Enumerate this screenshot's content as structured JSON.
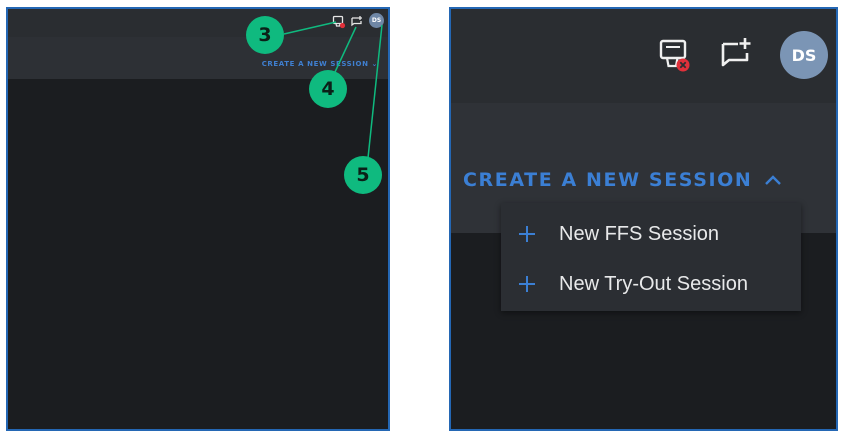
{
  "left_panel": {
    "avatar_initials": "DS",
    "create_session_label": "CREATE A NEW SESSION",
    "chevron": "chevron-down-icon",
    "callouts": [
      {
        "number": "3",
        "target": "notification-muted-icon"
      },
      {
        "number": "4",
        "target": "new-chat-icon"
      },
      {
        "number": "5",
        "target": "avatar"
      }
    ]
  },
  "right_panel": {
    "icons": [
      "notification-muted-icon",
      "new-chat-icon"
    ],
    "avatar_initials": "DS",
    "create_session_label": "CREATE A NEW SESSION",
    "chevron": "chevron-up-icon",
    "dropdown": {
      "items": [
        {
          "label": "New FFS Session",
          "icon": "plus-icon"
        },
        {
          "label": "New Try-Out Session",
          "icon": "plus-icon"
        }
      ]
    }
  },
  "colors": {
    "frame_border": "#2467b4",
    "accent_blue": "#3b7fd4",
    "callout_green": "#0fba7f",
    "error_red": "#e0303a",
    "avatar": "#7b95b5"
  }
}
